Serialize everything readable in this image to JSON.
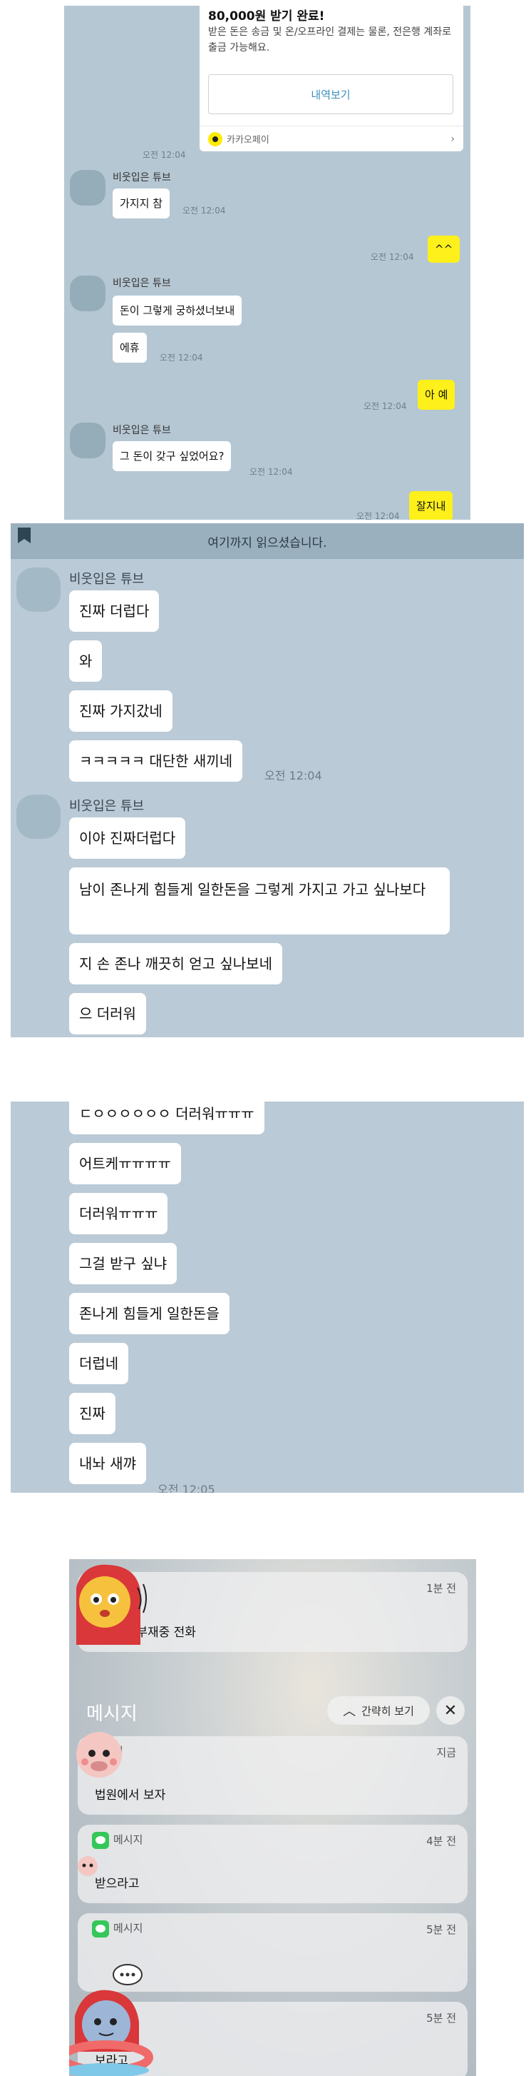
{
  "panel1": {
    "pay_card": {
      "title": "80,000원 받기 완료!",
      "desc": "받은 돈은 송금 및 온/오프라인 결제는 물론, 전은행 계좌로 출금 가능해요.",
      "button": "내역보기",
      "footer": "카카오페이",
      "footer_chevron": "›"
    },
    "pay_time": "오전 12:04",
    "sender": "비웃입은 튜브",
    "messages": [
      {
        "text": "가지지 참",
        "time": "오전 12:04"
      },
      {
        "text": "^^",
        "time": "오전 12:04"
      },
      {
        "text": "돈이 그렇게 궁하셨너보내"
      },
      {
        "text": "에휴",
        "time": "오전 12:04"
      },
      {
        "text": "아 예",
        "time": "오전 12:04"
      },
      {
        "text": "그 돈이 갖구 싶었어요?",
        "time": "오전 12:04"
      },
      {
        "text": "잘지내",
        "time": "오전 12:04"
      }
    ]
  },
  "panel2": {
    "read_marker": "여기까지 읽으셨습니다.",
    "sender": "비웃입은 튜브",
    "group1": [
      "진짜 더럽다",
      "와",
      "진짜 가지갔네",
      "ㅋㅋㅋㅋㅋ 대단한 새끼네"
    ],
    "group1_time": "오전 12:04",
    "group2": [
      "이야 진짜더럽다",
      "남이 존나게 힘들게 일한돈을 그렇게 가지고 가고 싶나보다",
      "지 손 존나 깨끗히 얻고 싶나보네",
      "으 더러워"
    ]
  },
  "panel3": {
    "messages": [
      "ㄷㅇㅇㅇㅇㅇㅇ 더러워ㅠㅠㅠ",
      "어트케ㅠㅠㅠㅠ",
      "더러워ㅠㅠㅠ",
      "그걸 받구 싶냐",
      "존나게 힘들게 일한돈을",
      "더럽네",
      "진짜",
      "내놔 새꺄"
    ],
    "last_time": "오전 12:05"
  },
  "panel4": {
    "top_notif": {
      "time": "1분 전",
      "body": "45통의 부재중 전화"
    },
    "section_title": "메시지",
    "brief_button": "간략히 보기",
    "close_glyph": "✕",
    "notifs": [
      {
        "app": "지",
        "time": "지금",
        "body": "법원에서 보자"
      },
      {
        "app": "메시지",
        "time": "4분 전",
        "body": "받으라고"
      },
      {
        "app": "메시지",
        "time": "5분 전",
        "body": ""
      },
      {
        "app": "",
        "time": "5분 전",
        "body": "보라고"
      }
    ]
  },
  "colors": {
    "chat_bg": "#b5c7d3",
    "my_bubble": "#fef01b",
    "their_bubble": "#ffffff",
    "kakaopay": "#ffeb00",
    "message_icon": "#34c759"
  },
  "icons": [
    "bookmark-icon",
    "kakaopay-icon",
    "chevron-right-icon",
    "chevron-up-icon",
    "close-icon",
    "messages-icon",
    "sticker-character"
  ]
}
